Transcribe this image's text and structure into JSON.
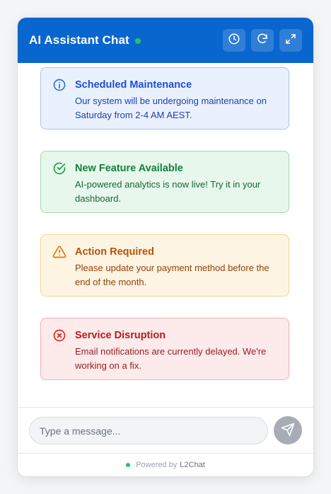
{
  "header": {
    "title": "AI Assistant Chat",
    "status_color": "#22c55e",
    "background_color": "#0a66cf",
    "buttons": [
      {
        "name": "history",
        "icon": "clock-icon"
      },
      {
        "name": "refresh",
        "icon": "refresh-icon"
      },
      {
        "name": "expand",
        "icon": "expand-icon"
      }
    ]
  },
  "messages": [
    {
      "type": "info",
      "icon": "info-circle-icon",
      "title": "Scheduled Maintenance",
      "text": "Our system will be undergoing maintenance on Saturday from 2-4 AM AEST.",
      "color": "#1d4ed8"
    },
    {
      "type": "success",
      "icon": "check-circle-icon",
      "title": "New Feature Available",
      "text": "AI-powered analytics is now live! Try it in your dashboard.",
      "color": "#15803d"
    },
    {
      "type": "warning",
      "icon": "warning-triangle-icon",
      "title": "Action Required",
      "text": "Please update your payment method before the end of the month.",
      "color": "#b45309"
    },
    {
      "type": "error",
      "icon": "x-circle-icon",
      "title": "Service Disruption",
      "text": "Email notifications are currently delayed. We're working on a fix.",
      "color": "#b91c1c"
    }
  ],
  "input": {
    "placeholder": "Type a message...",
    "value": "",
    "send_icon": "send-icon"
  },
  "footer": {
    "prefix": "Powered by",
    "brand": "L2Chat"
  }
}
